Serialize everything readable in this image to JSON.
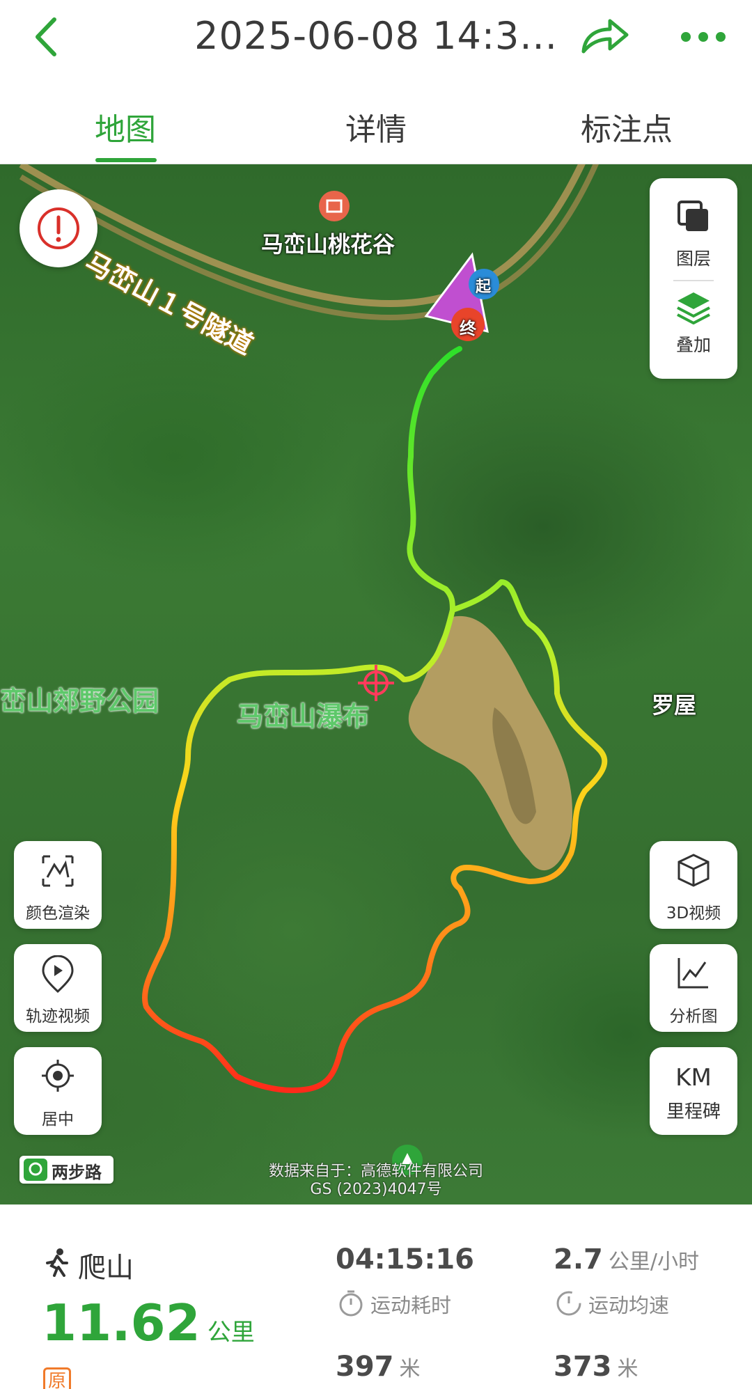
{
  "header": {
    "title": "2025-06-08 14:3...",
    "back_icon": "chevron-left-icon",
    "share_icon": "share-arrow-icon",
    "more_icon": "more-dots-icon",
    "accent_color": "#2fa53a"
  },
  "tabs": [
    {
      "label": "地图",
      "active": true
    },
    {
      "label": "详情",
      "active": false
    },
    {
      "label": "标注点",
      "active": false
    }
  ],
  "map": {
    "labels": {
      "poi": "马峦山桃花谷",
      "tunnel": "马峦山１号隧道",
      "park": "峦山郊野公园",
      "waterfall": "马峦山瀑布",
      "village": "罗屋"
    },
    "route_markers": {
      "start": "起",
      "end": "终"
    },
    "layer_panel": [
      {
        "label": "图层",
        "icon": "layers-square-icon"
      },
      {
        "label": "叠加",
        "icon": "stack-icon"
      }
    ],
    "left_buttons": [
      {
        "label": "颜色渲染",
        "icon": "color-render-icon"
      },
      {
        "label": "轨迹视频",
        "icon": "play-pin-icon"
      },
      {
        "label": "居中",
        "icon": "locate-icon"
      }
    ],
    "right_buttons": [
      {
        "label": "3D视频",
        "icon": "cube-icon"
      },
      {
        "label": "分析图",
        "icon": "line-chart-icon"
      },
      {
        "label": "里程碑",
        "top": "KM",
        "icon": "km-icon"
      }
    ],
    "brand": "两步路",
    "credit_line1": "数据来自于：高德软件有限公司",
    "credit_line2": "GS (2023)4047号"
  },
  "stats": {
    "activity": "爬山",
    "distance": "11.62",
    "distance_unit": "公里",
    "duration": "04:15:16",
    "duration_label": "运动耗时",
    "avg_speed": "2.7",
    "avg_speed_unit": "公里/小时",
    "avg_speed_label": "运动均速",
    "ascent": "397",
    "ascent_unit": "米",
    "descent": "373",
    "descent_unit": "米",
    "original_badge": "原"
  }
}
